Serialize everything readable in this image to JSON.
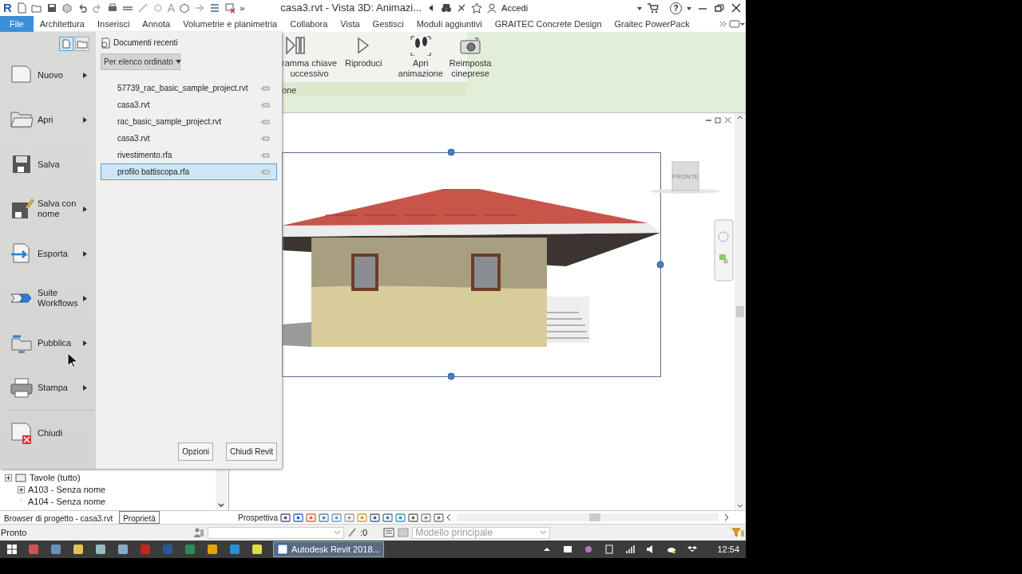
{
  "title_bar": {
    "logo": "R",
    "text_tool": "A",
    "overflow": "»",
    "title": "casa3.rvt - Vista 3D: Animazi...",
    "sign_in": "Accedi",
    "help": "?"
  },
  "ribbon_tabs": [
    {
      "label": "File",
      "selected": true
    },
    {
      "label": "Architettura",
      "selected": false
    },
    {
      "label": "Inserisci",
      "selected": false
    },
    {
      "label": "Annota",
      "selected": false
    },
    {
      "label": "Volumetrie e planimetria",
      "selected": false
    },
    {
      "label": "Collabora",
      "selected": false
    },
    {
      "label": "Vista",
      "selected": false
    },
    {
      "label": "Gestisci",
      "selected": false
    },
    {
      "label": "Moduli aggiuntivi",
      "selected": false
    },
    {
      "label": "GRAITEC Concrete Design",
      "selected": false
    },
    {
      "label": "Graitec PowerPack",
      "selected": false
    }
  ],
  "ribbon": {
    "buttons": [
      {
        "lines": [
          "ramma chiave",
          "uccessivo"
        ]
      },
      {
        "lines": [
          "Riproduci"
        ]
      },
      {
        "lines": [
          "Apri",
          "animazione"
        ]
      },
      {
        "lines": [
          "Reimposta",
          "cineprese"
        ]
      }
    ],
    "panel_label": "one"
  },
  "file_menu": {
    "items": [
      {
        "label": "Nuovo",
        "submenu": true
      },
      {
        "label": "Apri",
        "submenu": true
      },
      {
        "label": "Salva",
        "submenu": false
      },
      {
        "label": "Salva con nome",
        "submenu": true
      },
      {
        "label": "Esporta",
        "submenu": true
      },
      {
        "label": "Suite Workflows",
        "submenu": true
      },
      {
        "label": "Pubblica",
        "submenu": true
      },
      {
        "label": "Stampa",
        "submenu": true
      },
      {
        "label": "Chiudi",
        "submenu": false
      }
    ],
    "recent_header": "Documenti recenti",
    "sort": "Per elenco ordinato",
    "recent": [
      {
        "name": "57739_rac_basic_sample_project.rvt",
        "selected": false
      },
      {
        "name": "casa3.rvt",
        "selected": false
      },
      {
        "name": "rac_basic_sample_project.rvt",
        "selected": false
      },
      {
        "name": "casa3.rvt",
        "selected": false
      },
      {
        "name": "rivestimento.rfa",
        "selected": false
      },
      {
        "name": "profilo battiscopa.rfa",
        "selected": true
      }
    ],
    "buttons": [
      "Opzioni",
      "Chiudi Revit"
    ]
  },
  "project_browser": {
    "tree": [
      {
        "label": "Tavole (tutto)",
        "expandable": true,
        "children": [
          {
            "label": "A103 - Senza nome",
            "expandable": true
          },
          {
            "label": "A104 - Senza nome",
            "expandable": false
          }
        ]
      }
    ]
  },
  "bottom_tabs": [
    {
      "label": "Browser di progetto - casa3.rvt",
      "selected": false
    },
    {
      "label": "Proprietà",
      "selected": true
    }
  ],
  "view": {
    "viewcube": "FRONTE"
  },
  "view_bar": {
    "label": "Prospettiva"
  },
  "status_bar": {
    "text": "Pronto",
    "count": ":0",
    "model": "Modello principale"
  },
  "taskbar": {
    "app": "Autodesk Revit 2018...",
    "time": "12:54"
  }
}
